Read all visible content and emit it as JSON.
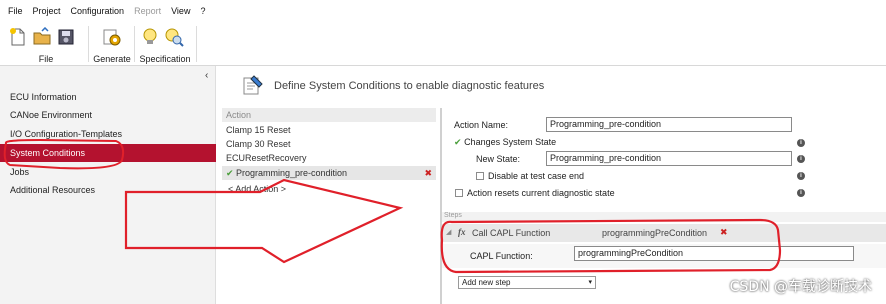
{
  "menu": [
    "File",
    "Project",
    "Configuration",
    "Report",
    "View",
    "?"
  ],
  "ribbon": {
    "groups": [
      {
        "label": "File",
        "icons": [
          "new-file-icon",
          "open-folder-icon",
          "save-icon"
        ]
      },
      {
        "label": "Generate",
        "icons": [
          "generate-gear-icon"
        ]
      },
      {
        "label": "Specification",
        "icons": [
          "lightbulb-icon",
          "spec-search-icon"
        ]
      }
    ]
  },
  "nav": {
    "collapse": "‹",
    "items": [
      "ECU Information",
      "CANoe Environment",
      "I/O Configuration-Templates",
      "System Conditions",
      "Jobs",
      "Additional Resources"
    ],
    "active_index": 3
  },
  "content": {
    "title": "Define System Conditions to enable diagnostic features"
  },
  "actions": {
    "header": "Action",
    "items": [
      "Clamp 15 Reset",
      "Clamp 30 Reset",
      "ECUResetRecovery",
      "Programming_pre-condition"
    ],
    "selected": "Programming_pre-condition",
    "add_label": "< Add Action >"
  },
  "properties": {
    "action_name_label": "Action Name:",
    "action_name_value": "Programming_pre-condition",
    "changes_system_state_label": "Changes System State",
    "new_state_label": "New State:",
    "new_state_value": "Programming_pre-condition",
    "disable_label": "Disable at test case end",
    "resets_label": "Action resets current diagnostic state",
    "info_glyph": "i"
  },
  "steps": {
    "section_label": "Steps",
    "step_type": "Call CAPL Function",
    "step_value": "programmingPreCondition",
    "detail_label": "CAPL Function:",
    "detail_value": "programmingPreCondition",
    "add_new_step": "Add new step"
  },
  "watermark": "CSDN @车载诊断技术",
  "colors": {
    "active_nav": "#b4122f",
    "annotation": "#e0202a"
  }
}
